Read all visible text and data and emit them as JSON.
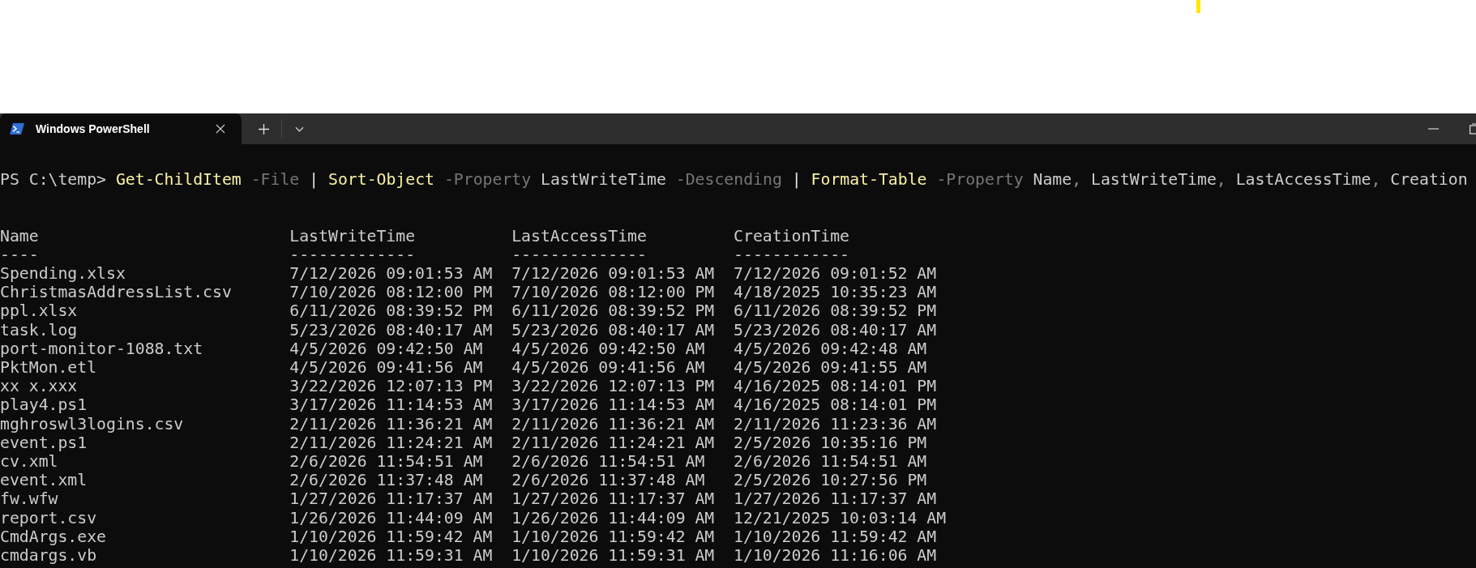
{
  "tabs": [
    {
      "title": "Windows PowerShell",
      "selected": true
    }
  ],
  "command": [
    {
      "kind": "prompt",
      "text": "PS C:\\temp>"
    },
    {
      "kind": "cmdlet",
      "text": "Get-ChildItem"
    },
    {
      "kind": "parameter",
      "text": "-File"
    },
    {
      "kind": "operator",
      "text": "|"
    },
    {
      "kind": "cmdlet",
      "text": "Sort-Object"
    },
    {
      "kind": "parameter",
      "text": "-Property"
    },
    {
      "kind": "argument",
      "text": "LastWriteTime"
    },
    {
      "kind": "parameter",
      "text": "-Descending"
    },
    {
      "kind": "operator",
      "text": "|"
    },
    {
      "kind": "cmdlet",
      "text": "Format-Table"
    },
    {
      "kind": "parameter",
      "text": "-Property"
    },
    {
      "kind": "argument",
      "text": "Name"
    },
    {
      "kind": "separator",
      "text": ","
    },
    {
      "kind": "argument",
      "text": "LastWriteTime"
    },
    {
      "kind": "separator",
      "text": ","
    },
    {
      "kind": "argument",
      "text": "LastAccessTime"
    },
    {
      "kind": "separator",
      "text": ","
    },
    {
      "kind": "argument",
      "text": "Creation"
    }
  ],
  "table": {
    "columns": [
      {
        "heading": "Name",
        "underline": "----"
      },
      {
        "heading": "LastWriteTime",
        "underline": "-------------"
      },
      {
        "heading": "LastAccessTime",
        "underline": "--------------"
      },
      {
        "heading": "CreationTime",
        "underline": "------------"
      }
    ],
    "rows": [
      [
        "Spending.xlsx",
        "7/12/2026 09:01:53 AM",
        "7/12/2026 09:01:53 AM",
        "7/12/2026 09:01:52 AM"
      ],
      [
        "ChristmasAddressList.csv",
        "7/10/2026 08:12:00 PM",
        "7/10/2026 08:12:00 PM",
        "4/18/2025 10:35:23 AM"
      ],
      [
        "ppl.xlsx",
        "6/11/2026 08:39:52 PM",
        "6/11/2026 08:39:52 PM",
        "6/11/2026 08:39:52 PM"
      ],
      [
        "task.log",
        "5/23/2026 08:40:17 AM",
        "5/23/2026 08:40:17 AM",
        "5/23/2026 08:40:17 AM"
      ],
      [
        "port-monitor-1088.txt",
        "4/5/2026 09:42:50 AM",
        "4/5/2026 09:42:50 AM",
        "4/5/2026 09:42:48 AM"
      ],
      [
        "PktMon.etl",
        "4/5/2026 09:41:56 AM",
        "4/5/2026 09:41:56 AM",
        "4/5/2026 09:41:55 AM"
      ],
      [
        "xx x.xxx",
        "3/22/2026 12:07:13 PM",
        "3/22/2026 12:07:13 PM",
        "4/16/2025 08:14:01 PM"
      ],
      [
        "play4.ps1",
        "3/17/2026 11:14:53 AM",
        "3/17/2026 11:14:53 AM",
        "4/16/2025 08:14:01 PM"
      ],
      [
        "mghroswl3logins.csv",
        "2/11/2026 11:36:21 AM",
        "2/11/2026 11:36:21 AM",
        "2/11/2026 11:23:36 AM"
      ],
      [
        "event.ps1",
        "2/11/2026 11:24:21 AM",
        "2/11/2026 11:24:21 AM",
        "2/5/2026 10:35:16 PM"
      ],
      [
        "cv.xml",
        "2/6/2026 11:54:51 AM",
        "2/6/2026 11:54:51 AM",
        "2/6/2026 11:54:51 AM"
      ],
      [
        "event.xml",
        "2/6/2026 11:37:48 AM",
        "2/6/2026 11:37:48 AM",
        "2/5/2026 10:27:56 PM"
      ],
      [
        "fw.wfw",
        "1/27/2026 11:17:37 AM",
        "1/27/2026 11:17:37 AM",
        "1/27/2026 11:17:37 AM"
      ],
      [
        "report.csv",
        "1/26/2026 11:44:09 AM",
        "1/26/2026 11:44:09 AM",
        "12/21/2025 10:03:14 AM"
      ],
      [
        "CmdArgs.exe",
        "1/10/2026 11:59:42 AM",
        "1/10/2026 11:59:42 AM",
        "1/10/2026 11:59:42 AM"
      ],
      [
        "cmdargs.vb",
        "1/10/2026 11:59:31 AM",
        "1/10/2026 11:59:31 AM",
        "1/10/2026 11:16:06 AM"
      ]
    ]
  }
}
